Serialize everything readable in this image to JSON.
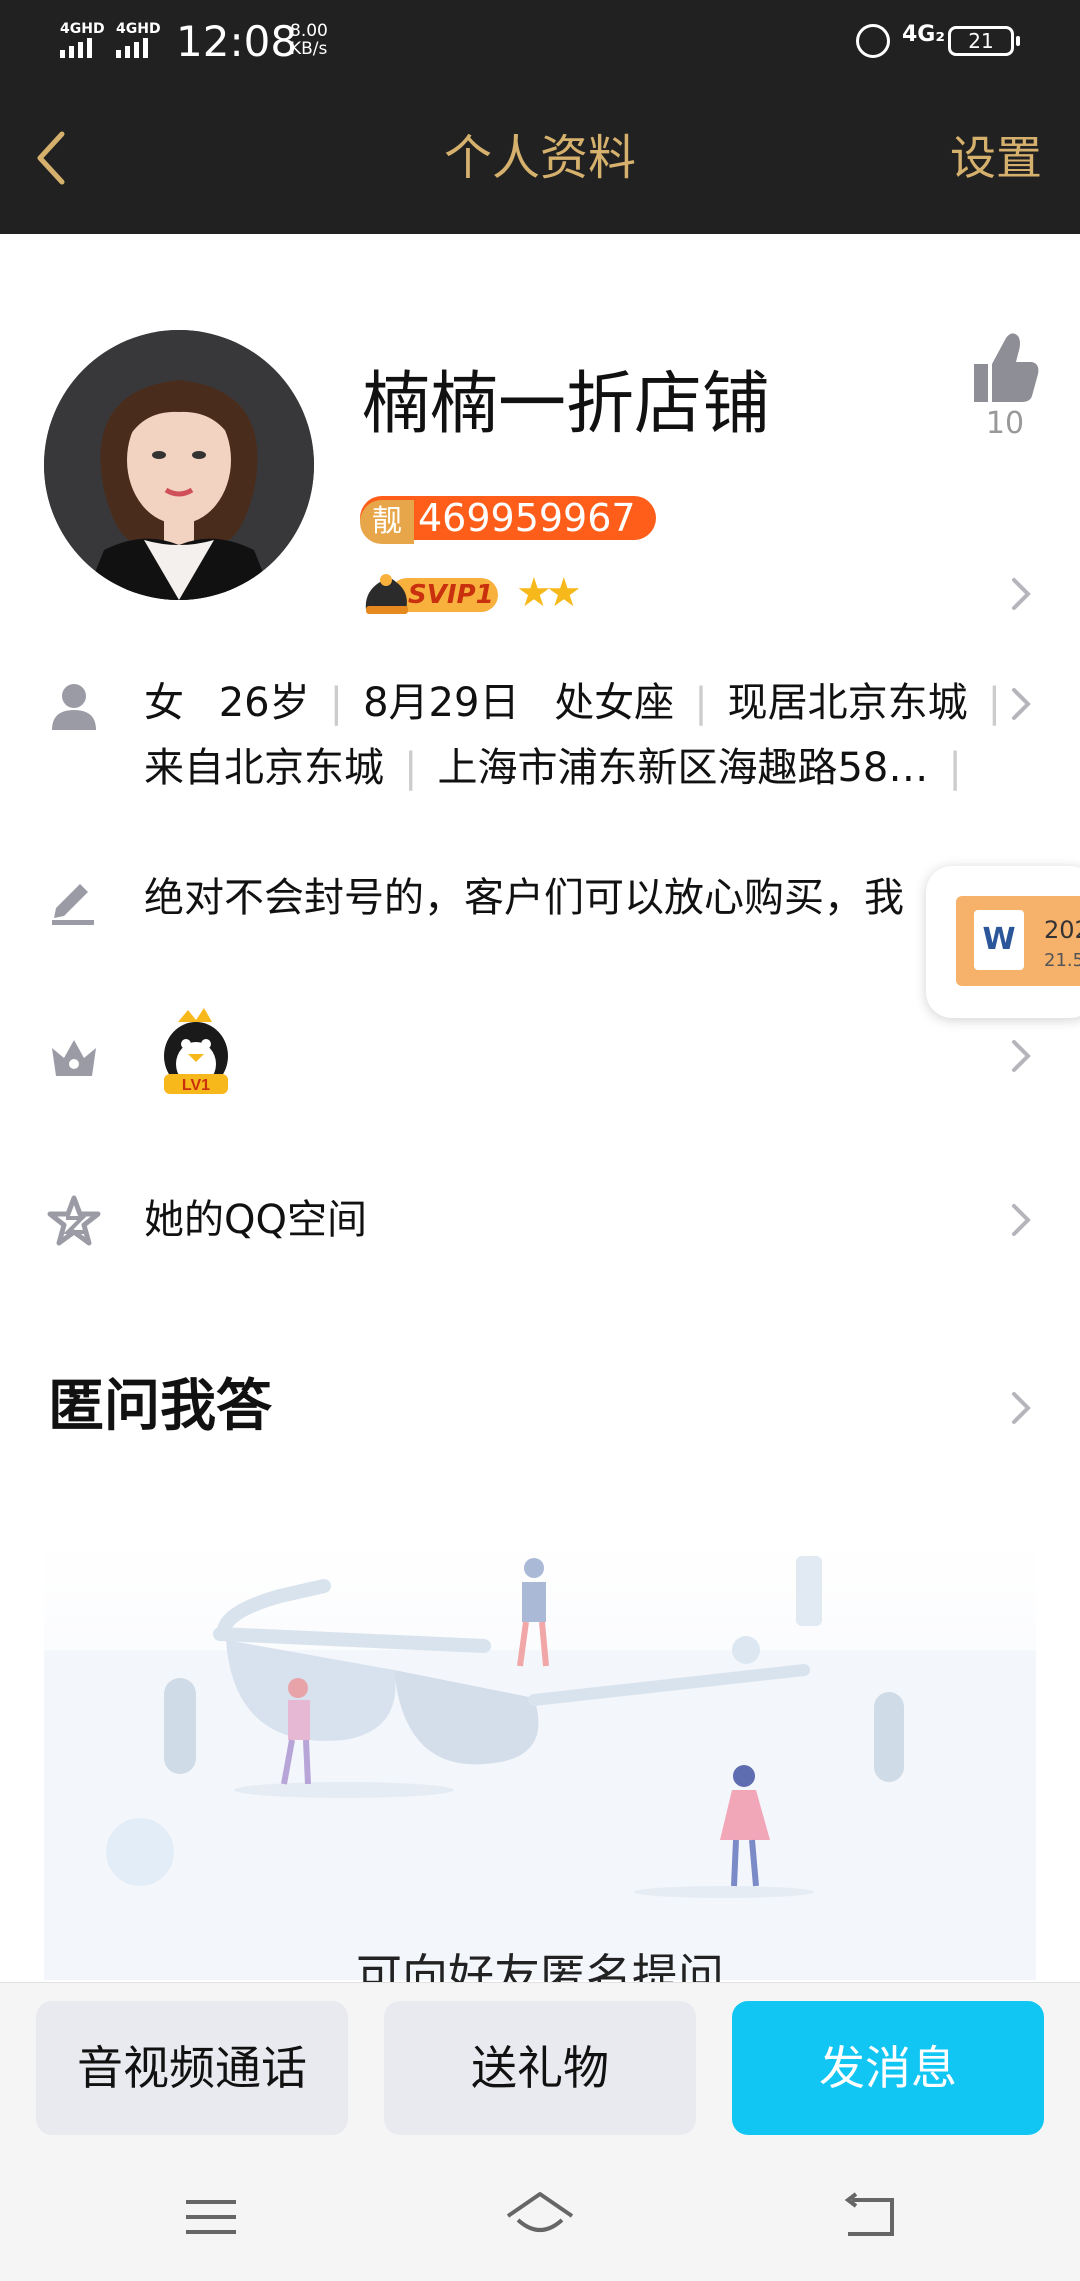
{
  "status_bar": {
    "signal_1": "4GHD",
    "signal_2": "4GHD",
    "time": "12:08",
    "speed_value": "8.00",
    "speed_unit": "KB/s",
    "network": "4G₂",
    "battery": "21"
  },
  "header": {
    "title": "个人资料",
    "settings_label": "设置"
  },
  "profile": {
    "name": "楠楠一折店铺",
    "like_count": "10",
    "badge_label": "靓",
    "qq_number": "469959967",
    "svip_label": "SVIP1",
    "stars": "★★"
  },
  "info": {
    "line1": [
      "女",
      "26岁",
      "8月29日",
      "处女座",
      "现居北京东城"
    ],
    "line2": [
      "来自北京东城",
      "上海市浦东新区海趣路58…"
    ]
  },
  "signature": "绝对不会封号的，客户们可以放心购买，我",
  "floating_card": {
    "icon_letter": "W",
    "title": "202",
    "subtitle": "21.5"
  },
  "level": {
    "label": "LV1"
  },
  "qzone": {
    "label": "她的QQ空间"
  },
  "anon_qa": {
    "title": "匿问我答",
    "caption": "可向好友匿名提问"
  },
  "actions": {
    "call": "音视频通话",
    "gift": "送礼物",
    "message": "发消息"
  },
  "colors": {
    "header_bg": "#212121",
    "gold": "#d5b16d",
    "primary": "#12c6f4",
    "badge_orange": "#ff5e1a"
  }
}
